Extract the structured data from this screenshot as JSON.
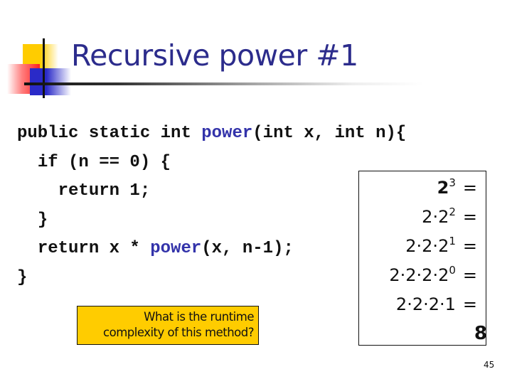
{
  "slide": {
    "title": "Recursive power #1",
    "page_number": "45",
    "accent_color": "#2c2c8c",
    "highlight_color": "#ffcc00"
  },
  "code": {
    "lines": [
      {
        "indent": "",
        "segments": [
          {
            "text": "public static int ",
            "style": "plain"
          },
          {
            "text": "power",
            "style": "method"
          },
          {
            "text": "(int x, int n){",
            "style": "plain"
          }
        ]
      },
      {
        "indent": "  ",
        "segments": [
          {
            "text": "if (n == 0) {",
            "style": "plain"
          }
        ]
      },
      {
        "indent": "    ",
        "segments": [
          {
            "text": "return 1;",
            "style": "plain"
          }
        ]
      },
      {
        "indent": "  ",
        "segments": [
          {
            "text": "}",
            "style": "plain"
          }
        ]
      },
      {
        "indent": "  ",
        "segments": [
          {
            "text": "return x * ",
            "style": "plain"
          },
          {
            "text": "power",
            "style": "method"
          },
          {
            "text": "(x, n-1);",
            "style": "plain"
          }
        ]
      },
      {
        "indent": "",
        "segments": [
          {
            "text": "}",
            "style": "plain"
          }
        ]
      }
    ]
  },
  "expansion": {
    "rows": [
      {
        "base": "2",
        "exp": "3",
        "bold": true,
        "suffix": "="
      },
      {
        "base": "2·2",
        "exp": "2",
        "bold": false,
        "suffix": "="
      },
      {
        "base": "2·2·2",
        "exp": "1",
        "bold": false,
        "suffix": "="
      },
      {
        "base": "2·2·2·2",
        "exp": "0",
        "bold": false,
        "suffix": "="
      },
      {
        "base": "2·2·2·1",
        "exp": "",
        "bold": false,
        "suffix": "="
      }
    ],
    "result": "8"
  },
  "question": {
    "line1": "What is the runtime",
    "line2": "complexity of this method?"
  }
}
